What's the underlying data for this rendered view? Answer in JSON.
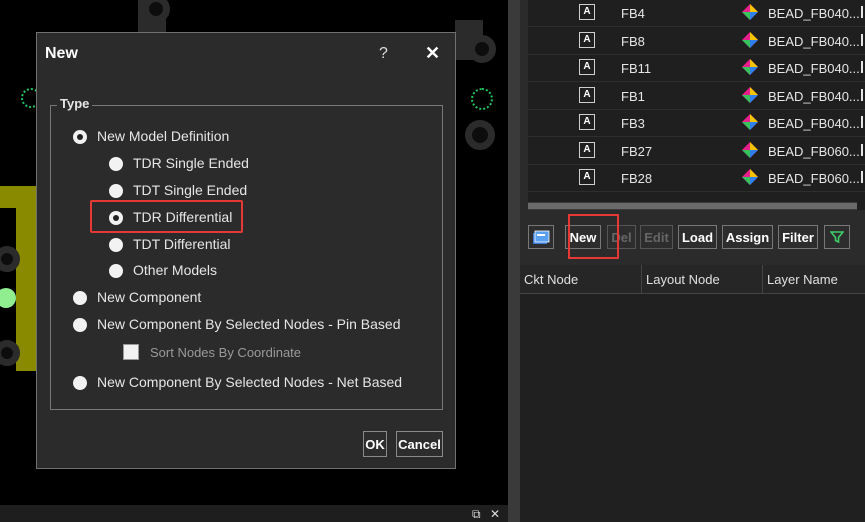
{
  "dialog": {
    "title": "New",
    "help_icon": "?",
    "close_icon": "✕",
    "group_label": "Type",
    "options": {
      "new_model_definition": "New Model Definition",
      "tdr_single_ended": "TDR Single Ended",
      "tdt_single_ended": "TDT Single Ended",
      "tdr_differential": "TDR Differential",
      "tdt_differential": "TDT Differential",
      "other_models": "Other Models",
      "new_component": "New Component",
      "new_component_pin": "New Component By Selected Nodes - Pin Based",
      "sort_nodes": "Sort Nodes By Coordinate",
      "new_component_net": "New Component By Selected Nodes - Net Based"
    },
    "selected_type": "New Model Definition",
    "selected_subtype": "TDR Differential",
    "ok_label": "OK",
    "cancel_label": "Cancel"
  },
  "component_list": {
    "rows": [
      {
        "checkbox_glyph": "A",
        "designator": "FB4",
        "part": "BEAD_FB040..."
      },
      {
        "checkbox_glyph": "A",
        "designator": "FB8",
        "part": "BEAD_FB040..."
      },
      {
        "checkbox_glyph": "A",
        "designator": "FB11",
        "part": "BEAD_FB040..."
      },
      {
        "checkbox_glyph": "A",
        "designator": "FB1",
        "part": "BEAD_FB040..."
      },
      {
        "checkbox_glyph": "A",
        "designator": "FB3",
        "part": "BEAD_FB040..."
      },
      {
        "checkbox_glyph": "A",
        "designator": "FB27",
        "part": "BEAD_FB060..."
      },
      {
        "checkbox_glyph": "A",
        "designator": "FB28",
        "part": "BEAD_FB060..."
      }
    ]
  },
  "toolbar": {
    "new_label": "New",
    "del_label": "Del",
    "edit_label": "Edit",
    "load_label": "Load",
    "assign_label": "Assign",
    "filter_label": "Filter"
  },
  "node_grid": {
    "headers": [
      "Ckt Node",
      "Layout Node",
      "Layer Name"
    ]
  },
  "window_controls": {
    "restore_glyph": "⧉",
    "close_glyph": "✕"
  },
  "colors": {
    "accent_highlight": "#e53935",
    "trace": "#8a8a00",
    "pad_ring": "#22c55e"
  }
}
